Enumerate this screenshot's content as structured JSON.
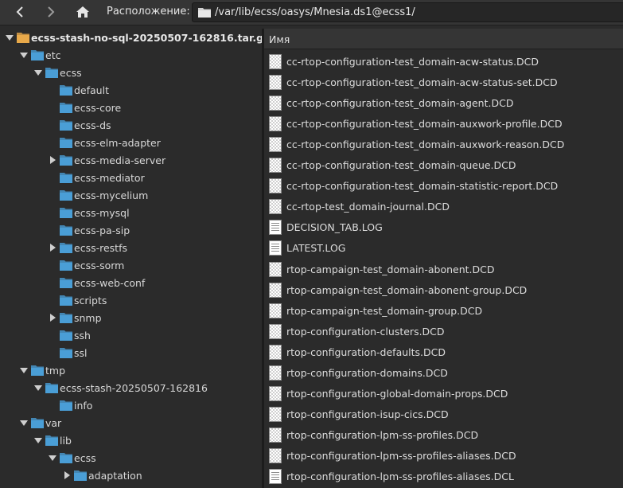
{
  "toolbar": {
    "location_label": "Расположение:",
    "path": "/var/lib/ecss/oasys/Mnesia.ds1@ecss1/"
  },
  "tree": [
    {
      "label": "ecss-stash-no-sql-20250507-162816.tar.gz",
      "depth": 0,
      "arrow": "down",
      "icon": "archive",
      "root": true
    },
    {
      "label": "etc",
      "depth": 1,
      "arrow": "down",
      "icon": "folder"
    },
    {
      "label": "ecss",
      "depth": 2,
      "arrow": "down",
      "icon": "folder"
    },
    {
      "label": "default",
      "depth": 3,
      "arrow": "none",
      "icon": "folder"
    },
    {
      "label": "ecss-core",
      "depth": 3,
      "arrow": "none",
      "icon": "folder"
    },
    {
      "label": "ecss-ds",
      "depth": 3,
      "arrow": "none",
      "icon": "folder"
    },
    {
      "label": "ecss-elm-adapter",
      "depth": 3,
      "arrow": "none",
      "icon": "folder"
    },
    {
      "label": "ecss-media-server",
      "depth": 3,
      "arrow": "right",
      "icon": "folder"
    },
    {
      "label": "ecss-mediator",
      "depth": 3,
      "arrow": "none",
      "icon": "folder"
    },
    {
      "label": "ecss-mycelium",
      "depth": 3,
      "arrow": "none",
      "icon": "folder"
    },
    {
      "label": "ecss-mysql",
      "depth": 3,
      "arrow": "none",
      "icon": "folder"
    },
    {
      "label": "ecss-pa-sip",
      "depth": 3,
      "arrow": "none",
      "icon": "folder"
    },
    {
      "label": "ecss-restfs",
      "depth": 3,
      "arrow": "right",
      "icon": "folder"
    },
    {
      "label": "ecss-sorm",
      "depth": 3,
      "arrow": "none",
      "icon": "folder"
    },
    {
      "label": "ecss-web-conf",
      "depth": 3,
      "arrow": "none",
      "icon": "folder"
    },
    {
      "label": "scripts",
      "depth": 3,
      "arrow": "none",
      "icon": "folder"
    },
    {
      "label": "snmp",
      "depth": 3,
      "arrow": "right",
      "icon": "folder"
    },
    {
      "label": "ssh",
      "depth": 3,
      "arrow": "none",
      "icon": "folder"
    },
    {
      "label": "ssl",
      "depth": 3,
      "arrow": "none",
      "icon": "folder"
    },
    {
      "label": "tmp",
      "depth": 1,
      "arrow": "down",
      "icon": "folder"
    },
    {
      "label": "ecss-stash-20250507-162816",
      "depth": 2,
      "arrow": "down",
      "icon": "folder"
    },
    {
      "label": "info",
      "depth": 3,
      "arrow": "none",
      "icon": "folder"
    },
    {
      "label": "var",
      "depth": 1,
      "arrow": "down",
      "icon": "folder"
    },
    {
      "label": "lib",
      "depth": 2,
      "arrow": "down",
      "icon": "folder"
    },
    {
      "label": "ecss",
      "depth": 3,
      "arrow": "down",
      "icon": "folder"
    },
    {
      "label": "adaptation",
      "depth": 4,
      "arrow": "right",
      "icon": "folder"
    }
  ],
  "list": {
    "column_name": "Имя",
    "files": [
      {
        "name": "cc-rtop-configuration-test_domain-acw-status.DCD",
        "icon": "binary-file-icon"
      },
      {
        "name": "cc-rtop-configuration-test_domain-acw-status-set.DCD",
        "icon": "binary-file-icon"
      },
      {
        "name": "cc-rtop-configuration-test_domain-agent.DCD",
        "icon": "binary-file-icon"
      },
      {
        "name": "cc-rtop-configuration-test_domain-auxwork-profile.DCD",
        "icon": "binary-file-icon"
      },
      {
        "name": "cc-rtop-configuration-test_domain-auxwork-reason.DCD",
        "icon": "binary-file-icon"
      },
      {
        "name": "cc-rtop-configuration-test_domain-queue.DCD",
        "icon": "binary-file-icon"
      },
      {
        "name": "cc-rtop-configuration-test_domain-statistic-report.DCD",
        "icon": "binary-file-icon"
      },
      {
        "name": "cc-rtop-test_domain-journal.DCD",
        "icon": "binary-file-icon"
      },
      {
        "name": "DECISION_TAB.LOG",
        "icon": "text-file-icon"
      },
      {
        "name": "LATEST.LOG",
        "icon": "text-file-icon"
      },
      {
        "name": "rtop-campaign-test_domain-abonent.DCD",
        "icon": "binary-file-icon"
      },
      {
        "name": "rtop-campaign-test_domain-abonent-group.DCD",
        "icon": "binary-file-icon"
      },
      {
        "name": "rtop-campaign-test_domain-group.DCD",
        "icon": "binary-file-icon"
      },
      {
        "name": "rtop-configuration-clusters.DCD",
        "icon": "binary-file-icon"
      },
      {
        "name": "rtop-configuration-defaults.DCD",
        "icon": "binary-file-icon"
      },
      {
        "name": "rtop-configuration-domains.DCD",
        "icon": "binary-file-icon"
      },
      {
        "name": "rtop-configuration-global-domain-props.DCD",
        "icon": "binary-file-icon"
      },
      {
        "name": "rtop-configuration-isup-cics.DCD",
        "icon": "binary-file-icon"
      },
      {
        "name": "rtop-configuration-lpm-ss-profiles.DCD",
        "icon": "binary-file-icon"
      },
      {
        "name": "rtop-configuration-lpm-ss-profiles-aliases.DCD",
        "icon": "binary-file-icon"
      },
      {
        "name": "rtop-configuration-lpm-ss-profiles-aliases.DCL",
        "icon": "text-file-icon"
      }
    ]
  },
  "colors": {
    "folder": "#4a9ed6",
    "archive": "#e8a94a",
    "background": "#2b2b2b",
    "header": "#353535"
  }
}
